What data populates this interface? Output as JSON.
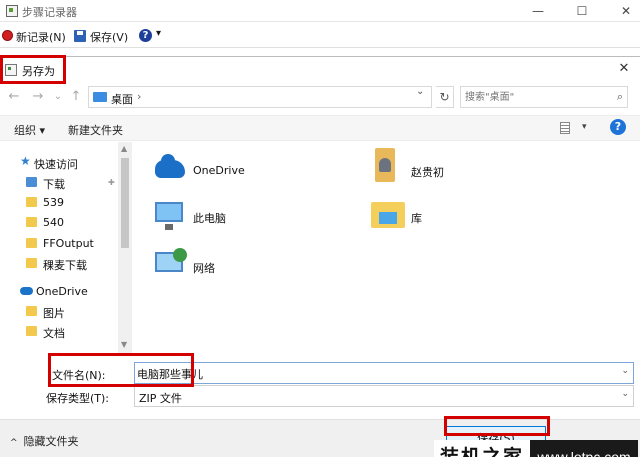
{
  "outer_window": {
    "title": "步骤记录器",
    "controls": {
      "minimize": "—",
      "maximize": "☐",
      "close": "✕"
    }
  },
  "recorder_toolbar": {
    "new_record_label": "新记录(N)",
    "save_label": "保存(V)",
    "help_symbol": "?",
    "help_dropdown": "▾"
  },
  "dialog": {
    "title": "另存为",
    "close_symbol": "✕",
    "nav": {
      "back": "←",
      "forward": "→",
      "dropdown": "⌄",
      "up": "↑"
    },
    "address": {
      "location": "桌面",
      "separator": "›",
      "dropdown": "⌄",
      "refresh": "↻"
    },
    "search": {
      "placeholder": "搜索\"桌面\"",
      "icon": "⌕"
    },
    "command_bar": {
      "organize_label": "组织 ▾",
      "new_folder_label": "新建文件夹",
      "view_dropdown": "▾",
      "help": "?"
    },
    "nav_pane": {
      "quick_access_label": "快速访问",
      "quick_items": [
        {
          "label": "下载",
          "pinned": true
        },
        {
          "label": "539"
        },
        {
          "label": "540"
        },
        {
          "label": "FFOutput"
        },
        {
          "label": "稞麦下载"
        }
      ],
      "pin_symbol": "📌",
      "onedrive_label": "OneDrive",
      "onedrive_items": [
        {
          "label": "图片"
        },
        {
          "label": "文档"
        }
      ],
      "scroll_up": "▲",
      "scroll_down": "▼"
    },
    "content": {
      "items": [
        {
          "label": "OneDrive",
          "icon": "onedrive-icon"
        },
        {
          "label": "赵贵初",
          "icon": "user-folder-icon"
        },
        {
          "label": "此电脑",
          "icon": "computer-icon"
        },
        {
          "label": "库",
          "icon": "library-icon"
        },
        {
          "label": "网络",
          "icon": "network-icon"
        }
      ]
    },
    "filename": {
      "label": "文件名(N):",
      "value": "电脑那些事儿",
      "dropdown": "⌄"
    },
    "filetype": {
      "label": "保存类型(T):",
      "value": "ZIP 文件",
      "dropdown": "⌄"
    },
    "hide_folders_label": "隐藏文件夹",
    "hide_folders_chevron": "^",
    "save_button_label": "保存(S)"
  },
  "watermark": {
    "chinese": "装机之家",
    "url": "www.lotpc.com"
  },
  "colors": {
    "highlight": "#d40000",
    "accent": "#0078d7"
  }
}
